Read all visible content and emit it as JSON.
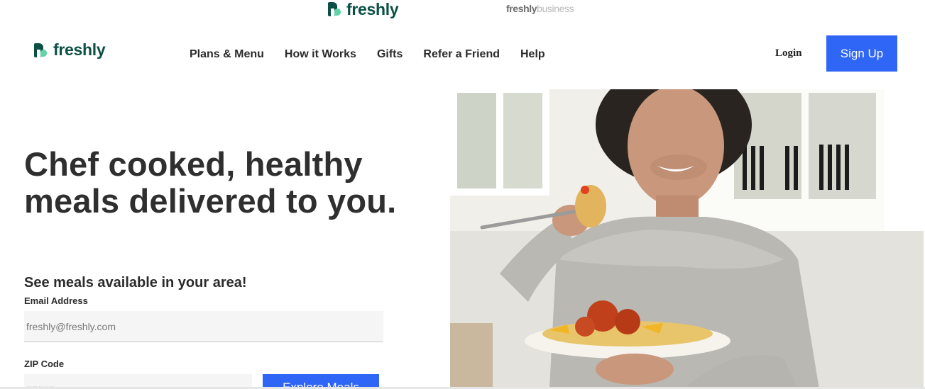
{
  "brand_switcher": {
    "freshly_label": "freshly",
    "business_label_part1": "freshly",
    "business_label_part2": "business"
  },
  "header": {
    "logo_text": "freshly",
    "nav": [
      {
        "label": "Plans & Menu"
      },
      {
        "label": "How it Works"
      },
      {
        "label": "Gifts"
      },
      {
        "label": "Refer a Friend"
      },
      {
        "label": "Help"
      }
    ],
    "login_label": "Login",
    "signup_label": "Sign Up"
  },
  "hero": {
    "title": "Chef cooked, healthy meals delivered to you.",
    "subtitle": "See meals available in your area!",
    "email_label": "Email Address",
    "email_placeholder": "freshly@freshly.com",
    "zip_label": "ZIP Code",
    "zip_placeholder": "#####",
    "cta_label": "Explore Meals"
  },
  "colors": {
    "brand_green": "#0b4f45",
    "brand_mint": "#5fd4a8",
    "accent_blue": "#2f66f6",
    "text_dark": "#2b2b2b"
  },
  "icons": {
    "brand_mark": "freshly-logo-icon"
  }
}
